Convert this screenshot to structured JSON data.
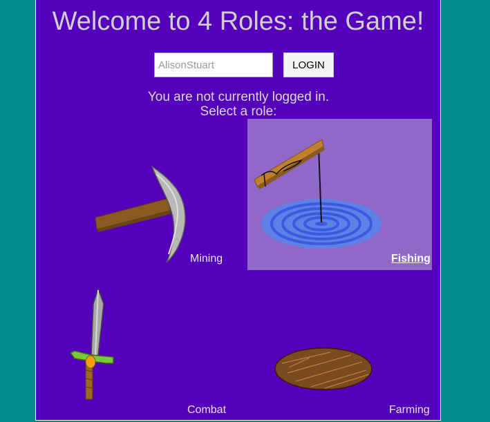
{
  "header": {
    "title": "Welcome to 4 Roles: the Game!"
  },
  "login": {
    "username_value": "AlisonStuart",
    "button_label": "LOGIN"
  },
  "status": {
    "line1": "You are not currently logged in.",
    "line2": "Select a role:"
  },
  "roles": [
    {
      "label": "Mining",
      "icon": "pickaxe-icon",
      "selected": false
    },
    {
      "label": "Fishing",
      "icon": "fishing-rod-icon",
      "selected": true
    },
    {
      "label": "Combat",
      "icon": "sword-icon",
      "selected": false
    },
    {
      "label": "Farming",
      "icon": "soil-plot-icon",
      "selected": false
    }
  ],
  "colors": {
    "page_background": "#008a8a",
    "panel_background": "#5500bb",
    "selected_tile": "#9068c8",
    "title_text": "#cfcfcf"
  }
}
